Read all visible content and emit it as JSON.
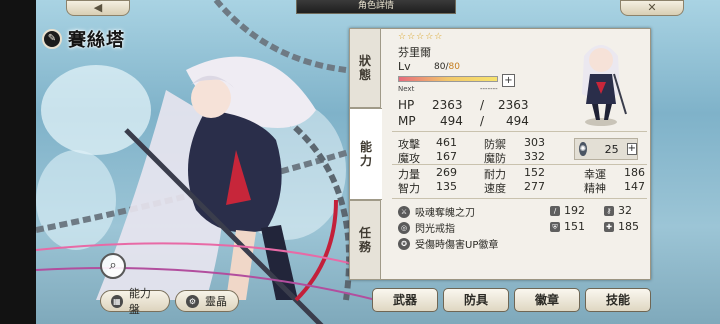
{
  "header": {
    "title": "角色詳情",
    "back_icon": "arrow-left",
    "close_icon": "x"
  },
  "character": {
    "title_name": "賽絲塔",
    "stars": "☆☆☆☆☆",
    "name": "芬里爾",
    "level_label": "Lv",
    "level": "80/",
    "level_max": "80",
    "exp_progress": 1.0,
    "next_label": "Next",
    "next_value": "-------"
  },
  "side_tabs": {
    "status": [
      "狀",
      "態"
    ],
    "ability": [
      "能",
      "力"
    ],
    "mission": [
      "任",
      "務"
    ]
  },
  "vitals": {
    "hp_label": "HP",
    "hp_cur": "2363",
    "hp_sep": "/",
    "hp_max": "2363",
    "mp_label": "MP",
    "mp_cur": "494",
    "mp_sep": "/",
    "mp_max": "494"
  },
  "stats": {
    "atk_label": "攻擊",
    "atk": "461",
    "def_label": "防禦",
    "def": "303",
    "matk_label": "魔攻",
    "matk": "167",
    "mdef_label": "魔防",
    "mdef": "332",
    "speed_points": "25",
    "str_label": "力量",
    "str": "269",
    "end_label": "耐力",
    "end": "152",
    "luck_label": "幸運",
    "luck": "186",
    "int_label": "智力",
    "int": "135",
    "spd_label": "速度",
    "spd": "277",
    "spr_label": "精神",
    "spr": "147"
  },
  "equipment": {
    "items": [
      "吸魂奪魄之刀",
      "閃光戒指",
      "受傷時傷害UP徽章"
    ],
    "sword_val": "192",
    "key_val": "32",
    "shield_val": "151",
    "cross_val": "185"
  },
  "bottom_left": {
    "ability_board": "能力盤",
    "relic": "靈晶"
  },
  "bottom_tabs": {
    "weapon": "武器",
    "armor": "防具",
    "badge": "徽章",
    "skill": "技能"
  }
}
